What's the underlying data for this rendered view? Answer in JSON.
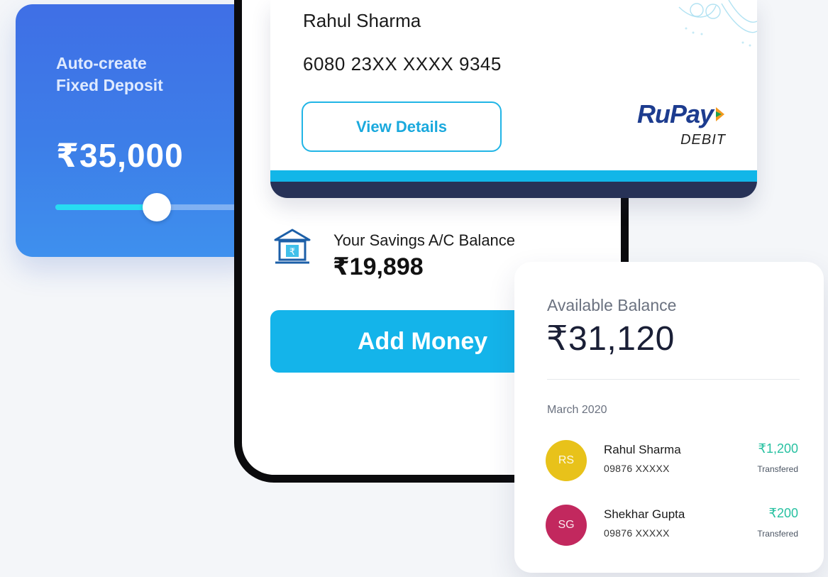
{
  "fd_card": {
    "title": "Auto-create\nFixed Deposit",
    "amount": "₹35,000",
    "slider_fraction": 0.55
  },
  "debit_card": {
    "holder_name": "Rahul Sharma",
    "number": "6080 23XX XXXX 9345",
    "view_details_label": "View Details",
    "brand": "RuPay",
    "type": "DEBIT"
  },
  "savings": {
    "label": "Your Savings A/C Balance",
    "amount": "₹19,898",
    "icon": "bank-icon"
  },
  "add_money_label": "Add Money",
  "balance_card": {
    "label": "Available Balance",
    "amount": "₹31,120",
    "month": "March 2020",
    "transactions": [
      {
        "initials": "RS",
        "name": "Rahul Sharma",
        "phone": "09876 XXXXX",
        "amount": "₹1,200",
        "status": "Transfered",
        "avatar_color": "#e8c21a"
      },
      {
        "initials": "SG",
        "name": "Shekhar Gupta",
        "phone": "09876 XXXXX",
        "amount": "₹200",
        "status": "Transfered",
        "avatar_color": "#c2285e"
      }
    ]
  },
  "colors": {
    "accent": "#14b4ea",
    "navy": "#273257",
    "positive": "#27c1a1",
    "fd_blue": "#3f6fe6"
  }
}
